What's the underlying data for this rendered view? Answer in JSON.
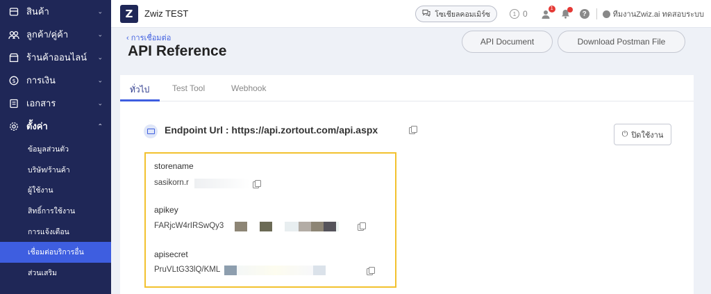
{
  "sidebar": {
    "items": [
      {
        "label": "สินค้า",
        "icon": "box-icon"
      },
      {
        "label": "ลูกค้า/คู่ค้า",
        "icon": "users-icon"
      },
      {
        "label": "ร้านค้าออนไลน์",
        "icon": "store-icon"
      },
      {
        "label": "การเงิน",
        "icon": "dollar-icon"
      },
      {
        "label": "เอกสาร",
        "icon": "document-icon"
      },
      {
        "label": "ตั้งค่า",
        "icon": "gear-icon"
      }
    ],
    "sub_items": [
      {
        "label": "ข้อมูลส่วนตัว"
      },
      {
        "label": "บริษัท/ร้านค้า"
      },
      {
        "label": "ผู้ใช้งาน"
      },
      {
        "label": "สิทธิ์การใช้งาน"
      },
      {
        "label": "การแจ้งเตือน"
      },
      {
        "label": "เชื่อมต่อบริการอื่น"
      },
      {
        "label": "ส่วนเสริม"
      }
    ]
  },
  "topbar": {
    "logo_text": "Z",
    "app_title": "Zwiz TEST",
    "social_button": "โซเชียลคอมเมิร์ซ",
    "coin_count": "0",
    "user_badge": "1",
    "user_name": "ทีมงานZwiz.ai ทดสอบระบบ"
  },
  "header": {
    "back_label": "การเชื่อมต่อ",
    "title": "API Reference",
    "api_doc_button": "API Document",
    "postman_button": "Download Postman File"
  },
  "tabs": [
    "ทั่วไป",
    "Test Tool",
    "Webhook"
  ],
  "endpoint": {
    "text": "Endpoint Url : https://api.zortout.com/api.aspx",
    "disable_button": "ปิดใช้งาน"
  },
  "credentials": {
    "storename_label": "storename",
    "storename_value": "sasikorn.r",
    "apikey_label": "apikey",
    "apikey_value": "FARjcW4rIRSwQy3",
    "apisecret_label": "apisecret",
    "apisecret_value": "PruVLtG33lQ/KML"
  },
  "colors": {
    "sidebar_bg": "#1f2757",
    "active_item": "#3e5ee0",
    "highlight_border": "#f2c12e"
  }
}
